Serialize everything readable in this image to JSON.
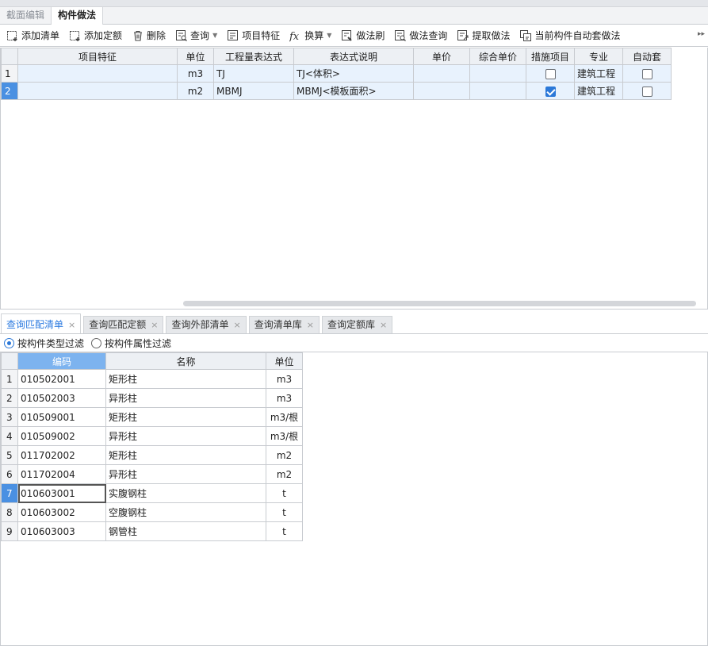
{
  "tabs": [
    {
      "label": "截面编辑",
      "active": false
    },
    {
      "label": "构件做法",
      "active": true
    }
  ],
  "toolbar": {
    "add_list": "添加清单",
    "add_quota": "添加定额",
    "delete": "删除",
    "query": "查询",
    "item_feature": "项目特征",
    "convert": "换算",
    "method_brush": "做法刷",
    "method_query": "做法查询",
    "extract_method": "提取做法",
    "auto_apply": "当前构件自动套做法"
  },
  "top_grid": {
    "headers": [
      "",
      "项目特征",
      "单位",
      "工程量表达式",
      "表达式说明",
      "单价",
      "综合单价",
      "措施项目",
      "专业",
      "自动套"
    ],
    "rows": [
      {
        "num": "1",
        "feature": "",
        "unit": "m3",
        "expr": "TJ",
        "desc": "TJ<体积>",
        "price": "",
        "comp_price": "",
        "measure": false,
        "major": "建筑工程",
        "auto": false
      },
      {
        "num": "2",
        "feature": "",
        "unit": "m2",
        "expr": "MBMJ",
        "desc": "MBMJ<模板面积>",
        "price": "",
        "comp_price": "",
        "measure": true,
        "major": "建筑工程",
        "auto": false
      }
    ]
  },
  "lower_tabs": [
    {
      "label": "查询匹配清单",
      "active": true
    },
    {
      "label": "查询匹配定额",
      "active": false
    },
    {
      "label": "查询外部清单",
      "active": false
    },
    {
      "label": "查询清单库",
      "active": false
    },
    {
      "label": "查询定额库",
      "active": false
    }
  ],
  "filter": {
    "by_type": "按构件类型过滤",
    "by_attr": "按构件属性过滤",
    "selected": "by_type"
  },
  "bottom_grid": {
    "headers": [
      "",
      "编码",
      "名称",
      "单位"
    ],
    "rows": [
      {
        "num": "1",
        "code": "010502001",
        "name": "矩形柱",
        "unit": "m3"
      },
      {
        "num": "2",
        "code": "010502003",
        "name": "异形柱",
        "unit": "m3"
      },
      {
        "num": "3",
        "code": "010509001",
        "name": "矩形柱",
        "unit": "m3/根"
      },
      {
        "num": "4",
        "code": "010509002",
        "name": "异形柱",
        "unit": "m3/根"
      },
      {
        "num": "5",
        "code": "011702002",
        "name": "矩形柱",
        "unit": "m2"
      },
      {
        "num": "6",
        "code": "011702004",
        "name": "异形柱",
        "unit": "m2"
      },
      {
        "num": "7",
        "code": "010603001",
        "name": "实腹钢柱",
        "unit": "t"
      },
      {
        "num": "8",
        "code": "010603002",
        "name": "空腹钢柱",
        "unit": "t"
      },
      {
        "num": "9",
        "code": "010603003",
        "name": "钢管柱",
        "unit": "t"
      }
    ]
  },
  "colors": {
    "accent": "#2b78d8",
    "row_selected": "#4a90e2",
    "header_highlight": "#7db3ef",
    "row_bg": "#e8f2fd"
  }
}
